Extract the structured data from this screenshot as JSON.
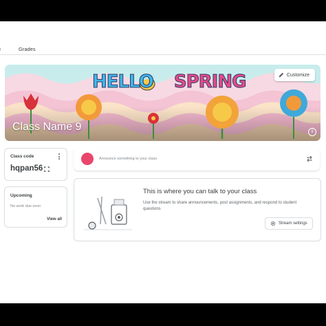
{
  "tabs": {
    "stream_label": "e",
    "grades_label": "Grades"
  },
  "banner": {
    "title_word1": "HELLO",
    "title_word2": "SPRING",
    "customize_label": "Customize",
    "class_name": "Class Name 9"
  },
  "class_code": {
    "label": "Class code",
    "value": "hqpan56"
  },
  "upcoming": {
    "label": "Upcoming",
    "text": "No work due soon",
    "view_all": "View all"
  },
  "announce": {
    "placeholder": "Announce something to your class"
  },
  "empty_state": {
    "title": "This is where you can talk to your class",
    "description": "Use the stream to share announcements, post assignments, and respond to student questions",
    "settings_label": "Stream settings"
  },
  "colors": {
    "accent": "#1e8e3e",
    "avatar": "#e8476b"
  },
  "icons": [
    "pencil-icon",
    "info-icon",
    "more-vert-icon",
    "fullscreen-icon",
    "repost-icon",
    "settings-gear-icon"
  ]
}
